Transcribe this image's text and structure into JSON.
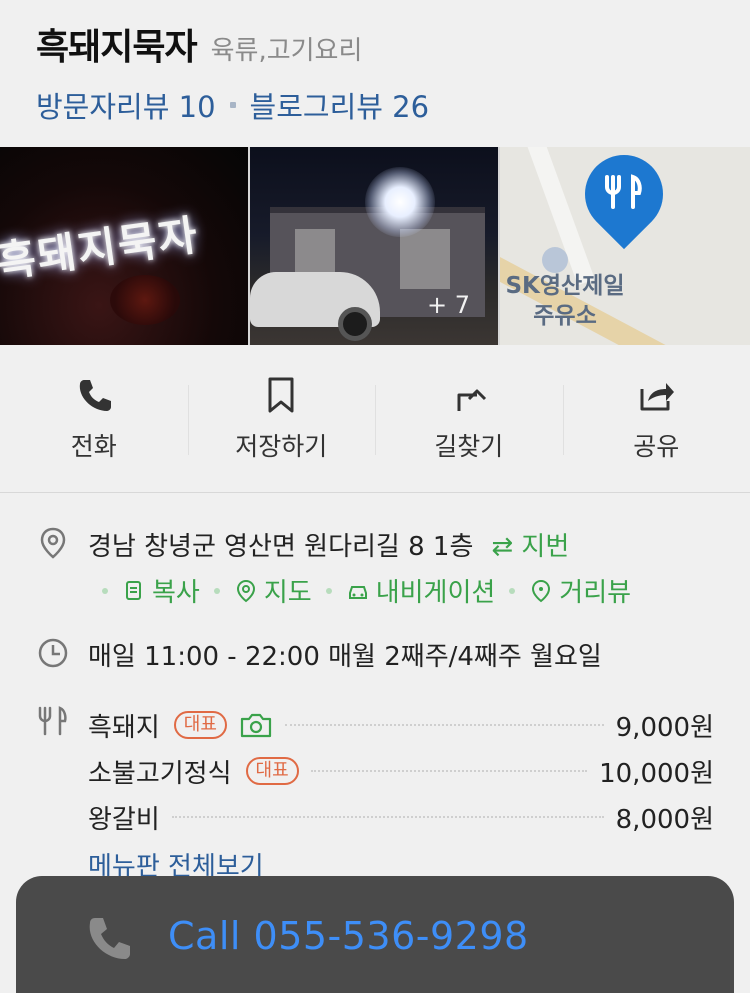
{
  "place": {
    "name": "흑돼지묵자",
    "category": "육류,고기요리"
  },
  "reviews": {
    "visitor_label": "방문자리뷰 10",
    "blog_label": "블로그리뷰 26"
  },
  "photos": {
    "more_count": "+ 7",
    "sign_text": "흑돼지묵자",
    "map_label_line1": "SK영산제일",
    "map_label_line2": "주유소"
  },
  "actions": [
    {
      "label": "전화",
      "icon": "phone-icon"
    },
    {
      "label": "저장하기",
      "icon": "bookmark-icon"
    },
    {
      "label": "길찾기",
      "icon": "directions-icon"
    },
    {
      "label": "공유",
      "icon": "share-icon"
    }
  ],
  "address": {
    "text": "경남 창녕군 영산면 원다리길 8 1층",
    "lot_number_toggle": "⇄ 지번",
    "links": [
      {
        "label": "복사",
        "icon": "copy-icon"
      },
      {
        "label": "지도",
        "icon": "map-pin-icon"
      },
      {
        "label": "내비게이션",
        "icon": "car-icon"
      },
      {
        "label": "거리뷰",
        "icon": "streetview-pin-icon"
      }
    ]
  },
  "hours": {
    "text": "매일 11:00 - 22:00 매월 2째주/4째주 월요일"
  },
  "menu": {
    "items": [
      {
        "name": "흑돼지",
        "badge": "대표",
        "has_photo": true,
        "price": "9,000원"
      },
      {
        "name": "소불고기정식",
        "badge": "대표",
        "has_photo": false,
        "price": "10,000원"
      },
      {
        "name": "왕갈비",
        "badge": "",
        "has_photo": false,
        "price": "8,000원"
      }
    ],
    "view_all": "메뉴판 전체보기"
  },
  "call_sheet": {
    "label": "Call 055-536-9298"
  },
  "colors": {
    "link_blue": "#2d5e9a",
    "green": "#3aa24a",
    "badge_orange": "#e06a44",
    "call_blue": "#3e8ef7",
    "call_sheet_bg": "#4a4a4a"
  }
}
